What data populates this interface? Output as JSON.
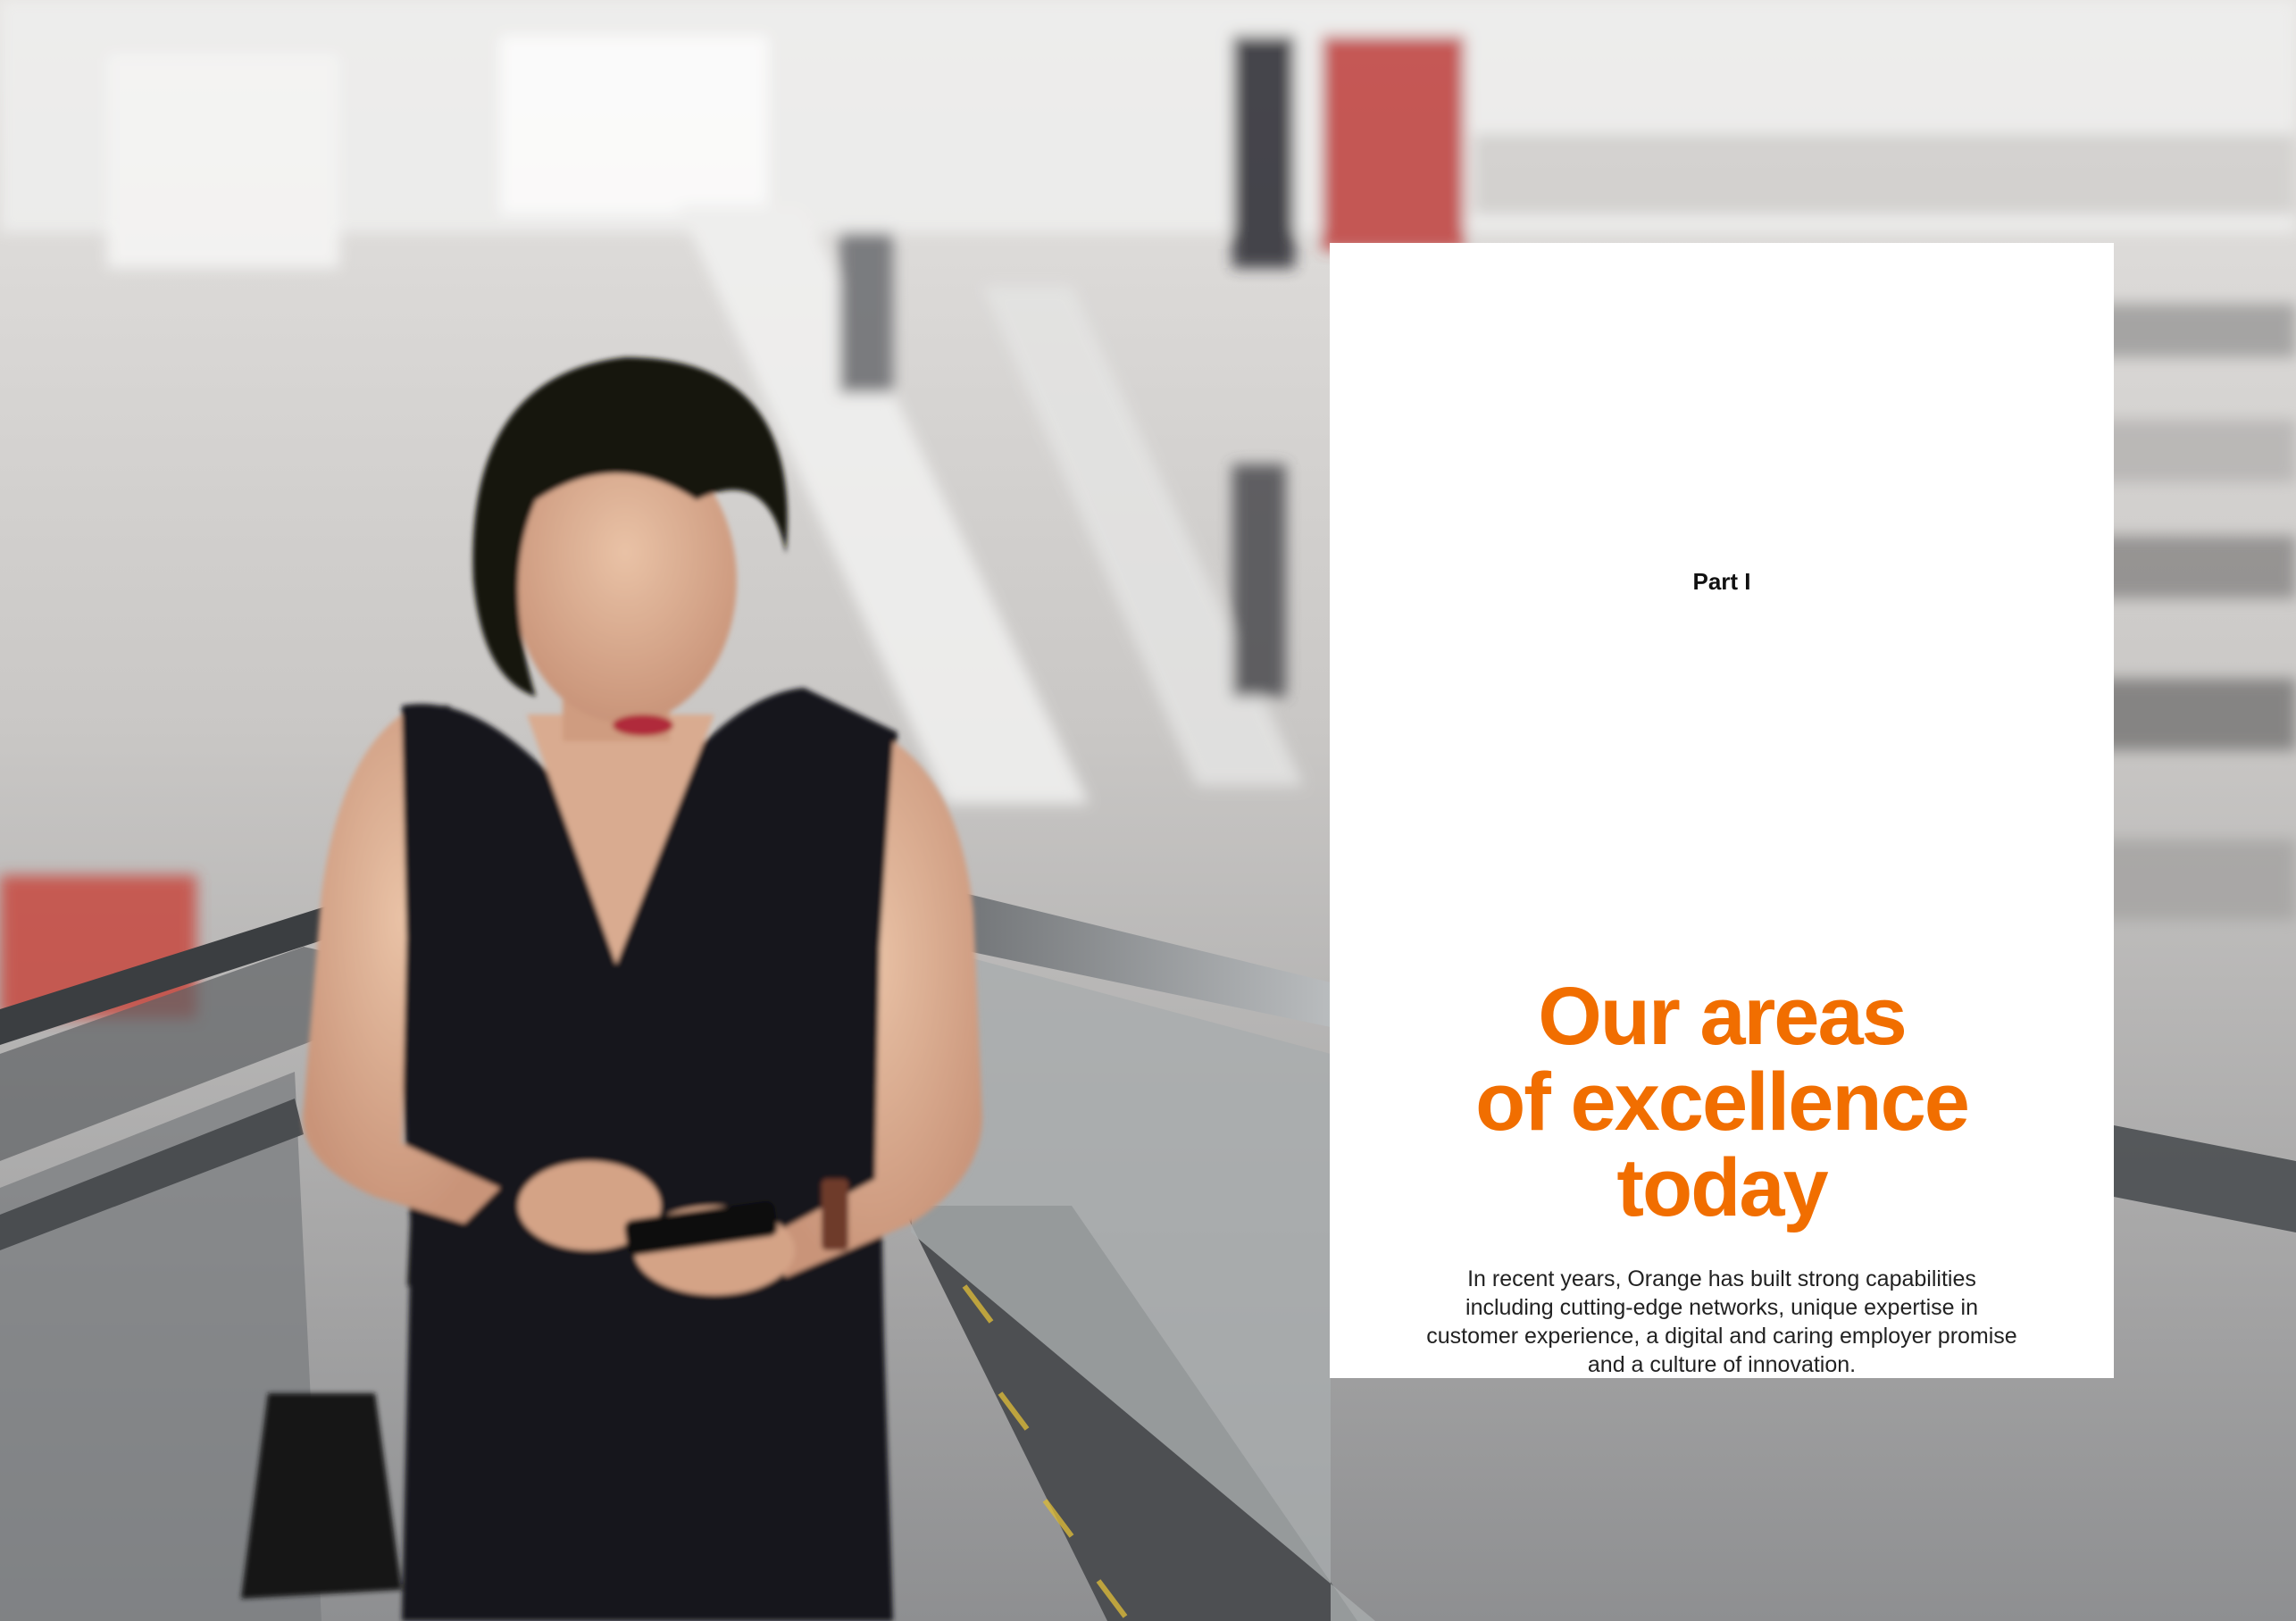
{
  "page": {
    "part_label": "Part I",
    "headline_lines": [
      "Our areas",
      "of excellence",
      "today"
    ],
    "intro_lines": [
      "In recent years, Orange has built strong capabilities",
      "including cutting-edge networks, unique expertise in",
      "customer experience, a digital and caring employer promise",
      "and a culture of innovation."
    ]
  },
  "colors": {
    "accent": "#f16e00",
    "panel": "#ffffff",
    "text": "#222222"
  },
  "icons": {
    "background_photo": "woman-on-escalator-with-phone-photo"
  }
}
